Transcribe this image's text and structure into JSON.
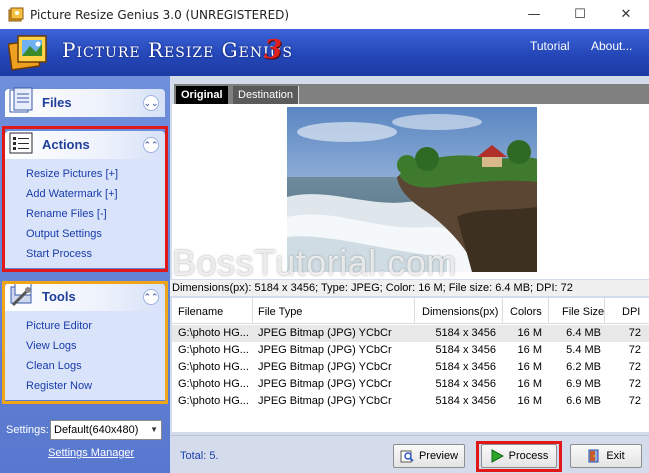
{
  "window": {
    "title": "Picture Resize Genius 3.0 (UNREGISTERED)",
    "controls": {
      "minimize": "—",
      "maximize": "☐",
      "close": "✕"
    }
  },
  "banner": {
    "title": "Picture Resize Genius",
    "version": "3",
    "links": [
      "Tutorial",
      "About..."
    ]
  },
  "sidebar": {
    "files": {
      "title": "Files",
      "chevron": "⌄⌄"
    },
    "actions": {
      "title": "Actions",
      "chevron": "⌃⌃",
      "items": [
        "Resize Pictures [+]",
        "Add Watermark [+]",
        "Rename Files [-]",
        "Output Settings",
        "Start Process"
      ]
    },
    "tools": {
      "title": "Tools",
      "chevron": "⌃⌃",
      "items": [
        "Picture Editor",
        "View Logs",
        "Clean Logs",
        "Register Now"
      ]
    },
    "settings": {
      "label": "Settings:",
      "selected": "Default(640x480)",
      "manager": "Settings Manager"
    }
  },
  "tabs": [
    "Original",
    "Destination"
  ],
  "watermark_text": "BossTutorial.com",
  "info_line": "Dimensions(px): 5184 x 3456; Type: JPEG; Color: 16 M; File size: 6.4 MB; DPI: 72",
  "table": {
    "columns": [
      "Filename",
      "File Type",
      "Dimensions(px)",
      "Colors",
      "File Size",
      "DPI"
    ],
    "rows": [
      [
        "G:\\photo HG...",
        "JPEG Bitmap (JPG) YCbCr",
        "5184 x 3456",
        "16 M",
        "6.4 MB",
        "72"
      ],
      [
        "G:\\photo HG...",
        "JPEG Bitmap (JPG) YCbCr",
        "5184 x 3456",
        "16 M",
        "5.4 MB",
        "72"
      ],
      [
        "G:\\photo HG...",
        "JPEG Bitmap (JPG) YCbCr",
        "5184 x 3456",
        "16 M",
        "6.2 MB",
        "72"
      ],
      [
        "G:\\photo HG...",
        "JPEG Bitmap (JPG) YCbCr",
        "5184 x 3456",
        "16 M",
        "6.9 MB",
        "72"
      ],
      [
        "G:\\photo HG...",
        "JPEG Bitmap (JPG) YCbCr",
        "5184 x 3456",
        "16 M",
        "6.6 MB",
        "72"
      ]
    ]
  },
  "footer": {
    "total": "Total: 5.",
    "buttons": {
      "preview": "Preview",
      "process": "Process",
      "exit": "Exit"
    }
  },
  "colors": {
    "banner": "#2547b8",
    "sidebar": "#5878cf",
    "panel_body": "#d9e3fa",
    "link": "#1a3caa",
    "highlight_red": "#e01818",
    "highlight_orange": "#f0a418"
  }
}
